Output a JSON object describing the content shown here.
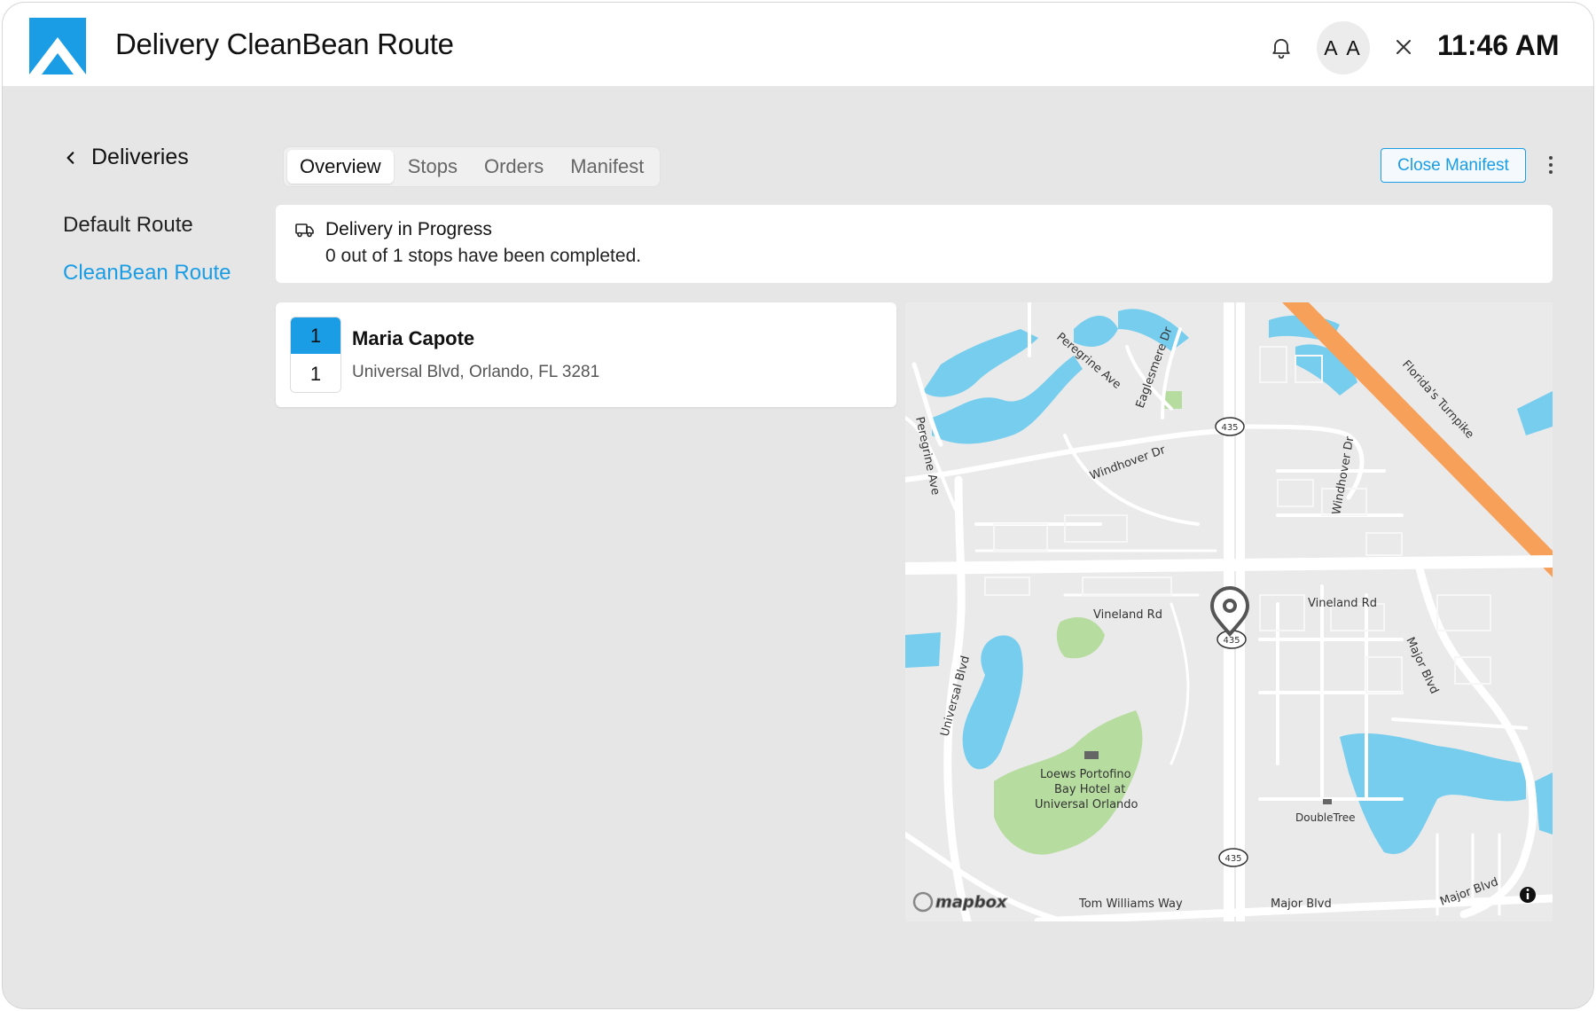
{
  "header": {
    "title": "Delivery CleanBean Route",
    "text_size_label": "A A",
    "time": "11:46 AM"
  },
  "sidebar": {
    "back_label": "Deliveries",
    "items": [
      {
        "label": "Default Route",
        "active": false
      },
      {
        "label": "CleanBean Route",
        "active": true
      }
    ]
  },
  "tabs": [
    {
      "label": "Overview",
      "active": true
    },
    {
      "label": "Stops",
      "active": false
    },
    {
      "label": "Orders",
      "active": false
    },
    {
      "label": "Manifest",
      "active": false
    }
  ],
  "actions": {
    "close_manifest_label": "Close Manifest"
  },
  "status": {
    "title": "Delivery in Progress",
    "subtitle": "0 out of 1 stops have been completed."
  },
  "stops": [
    {
      "sequence": "1",
      "count": "1",
      "name": "Maria Capote",
      "address": "Universal Blvd, Orlando, FL 3281"
    }
  ],
  "map": {
    "labels": {
      "peregrine_ave_top": "Peregrine Ave",
      "eaglesmere_dr": "Eaglesmere Dr",
      "peregrine_ave_left": "Peregrine Ave",
      "windhover_dr_1": "Windhover Dr",
      "windhover_dr_2": "Windhover Dr",
      "florida_turnpike": "Florida's Turnpike",
      "vineland_rd_1": "Vineland Rd",
      "vineland_rd_2": "Vineland Rd",
      "universal_blvd": "Universal Blvd",
      "major_blvd_1": "Major Blvd",
      "major_blvd_2": "Major Blvd",
      "major_blvd_3": "Major Blvd",
      "hotel_line1": "Loews Portofino",
      "hotel_line2": "Bay Hotel at",
      "hotel_line3": "Universal Orlando",
      "doubletree": "DoubleTree",
      "tom_williams_way": "Tom Williams Way",
      "route_shield": "435",
      "attribution": "mapbox"
    },
    "colors": {
      "water": "#76cdee",
      "park": "#b6dca0",
      "highway": "#f6a05a",
      "land": "#eaeaea",
      "road": "#ffffff"
    }
  },
  "colors": {
    "accent": "#1a9de5",
    "background": "#e6e6e6"
  }
}
